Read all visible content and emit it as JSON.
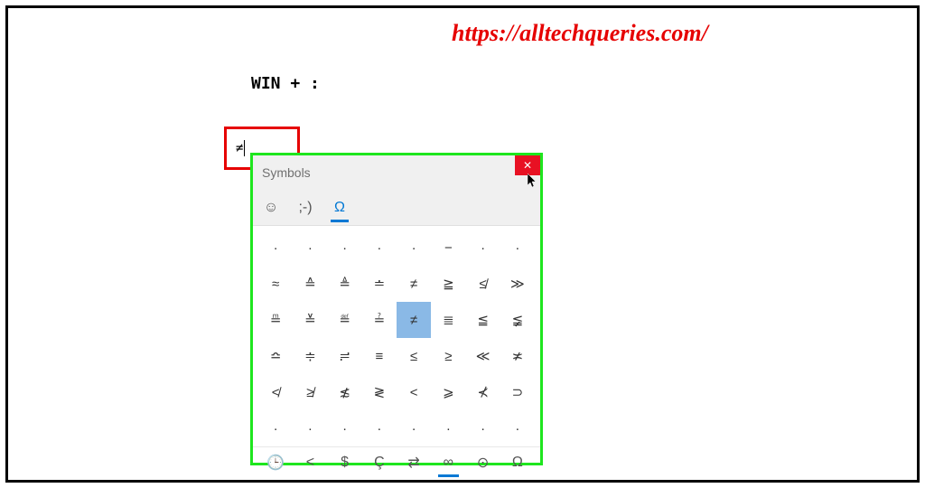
{
  "watermark": "https://alltechqueries.com/",
  "heading": "WIN + :",
  "input": {
    "value": "≠"
  },
  "panel": {
    "title": "Symbols",
    "close_glyph": "✕",
    "tabs": {
      "emoji": "☺",
      "kaomoji": ";-)",
      "symbols": "Ω"
    },
    "grid": [
      [
        "·",
        "·",
        "·",
        "·",
        "·",
        "−",
        "·",
        "·"
      ],
      [
        "≈",
        "≙",
        "≜",
        "≐",
        "≠",
        "≧",
        "≰",
        "≫"
      ],
      [
        "≞",
        "≚",
        "≝",
        "≟",
        "≠",
        "≣",
        "≦",
        "≨"
      ],
      [
        "≏",
        "≑",
        "≓",
        "≡",
        "≤",
        "≥",
        "≪",
        "≭"
      ],
      [
        "≮",
        "≱",
        "≴",
        "≷",
        "<",
        "⩾",
        "⊀",
        "⊃"
      ],
      [
        "·",
        "·",
        "·",
        "·",
        "·",
        "·",
        "·",
        "·"
      ]
    ],
    "selected_row": 2,
    "selected_col": 4,
    "categories": [
      "🕒",
      "<",
      "$",
      "Ç",
      "⇄",
      "∞",
      "⊙",
      "Ω"
    ],
    "active_category": 5,
    "colors": {
      "accent": "#0078d4",
      "close_bg": "#e81123",
      "highlight": "#8ab9e6",
      "frame_green": "#1ee61e",
      "frame_red": "#e60000"
    }
  }
}
